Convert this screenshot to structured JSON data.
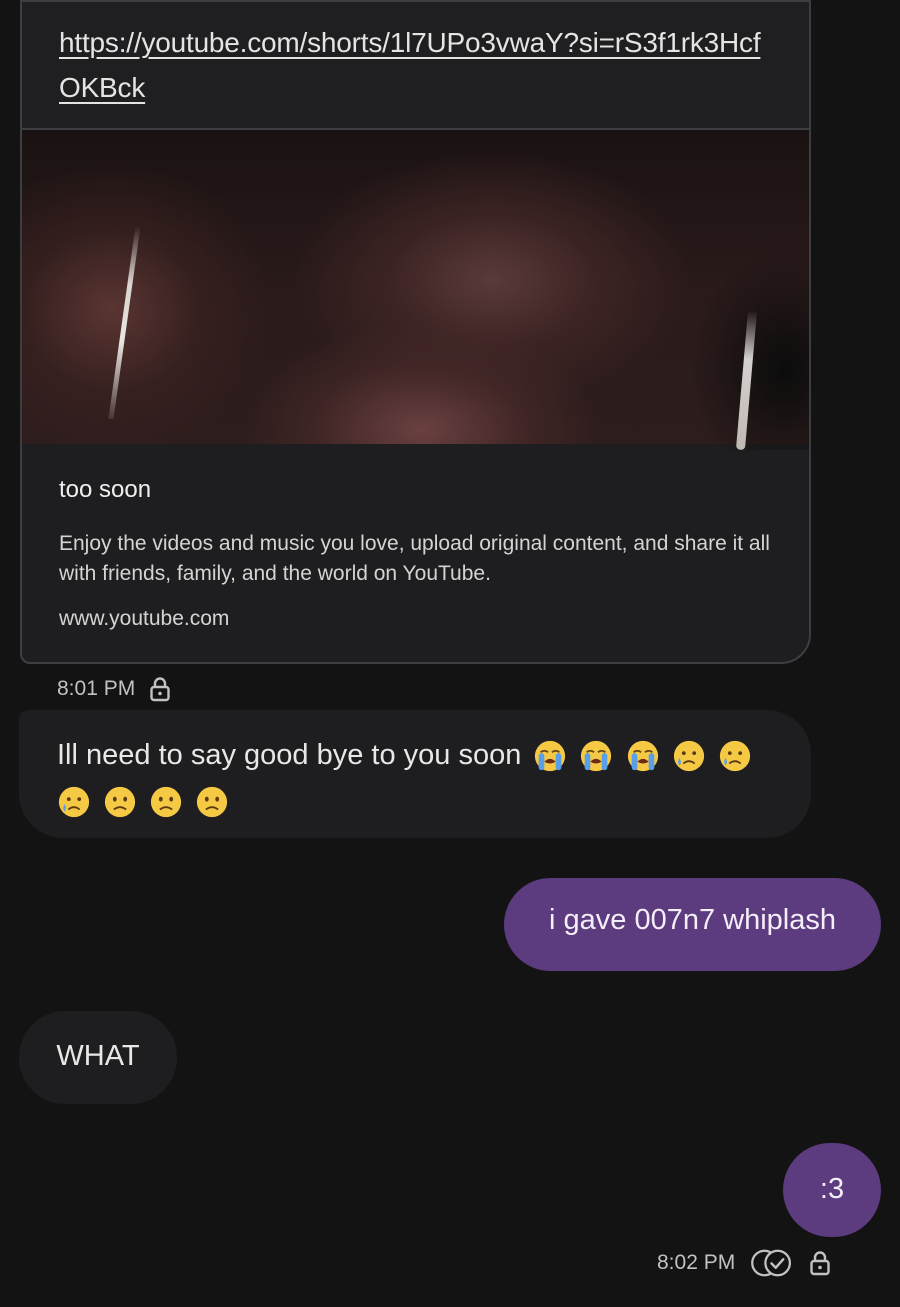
{
  "link_card": {
    "url": "https://youtube.com/shorts/1l7UPo3vwaY?si=rS3f1rk3HcfOKBck",
    "title": "too soon",
    "description": "Enjoy the videos and music you love, upload original content, and share it all with friends, family, and the world on YouTube.",
    "site": "www.youtube.com"
  },
  "messages": [
    {
      "time": "8:01 PM"
    },
    {
      "text": "Ill need to say good bye to you soon",
      "emojis": [
        "loudly-crying-face",
        "loudly-crying-face",
        "loudly-crying-face",
        "sad-but-relieved-face",
        "sad-but-relieved-face",
        "sad-but-relieved-face",
        "slightly-frowning-face",
        "slightly-frowning-face",
        "slightly-frowning-face"
      ]
    },
    {
      "text": "i gave 007n7 whiplash"
    },
    {
      "text": "WHAT"
    },
    {
      "text": ":3"
    },
    {
      "time": "8:02 PM"
    }
  ],
  "colors": {
    "background": "#131314",
    "incoming_bubble": "#1e1e20",
    "outgoing_bubble": "#5c3b7e"
  }
}
